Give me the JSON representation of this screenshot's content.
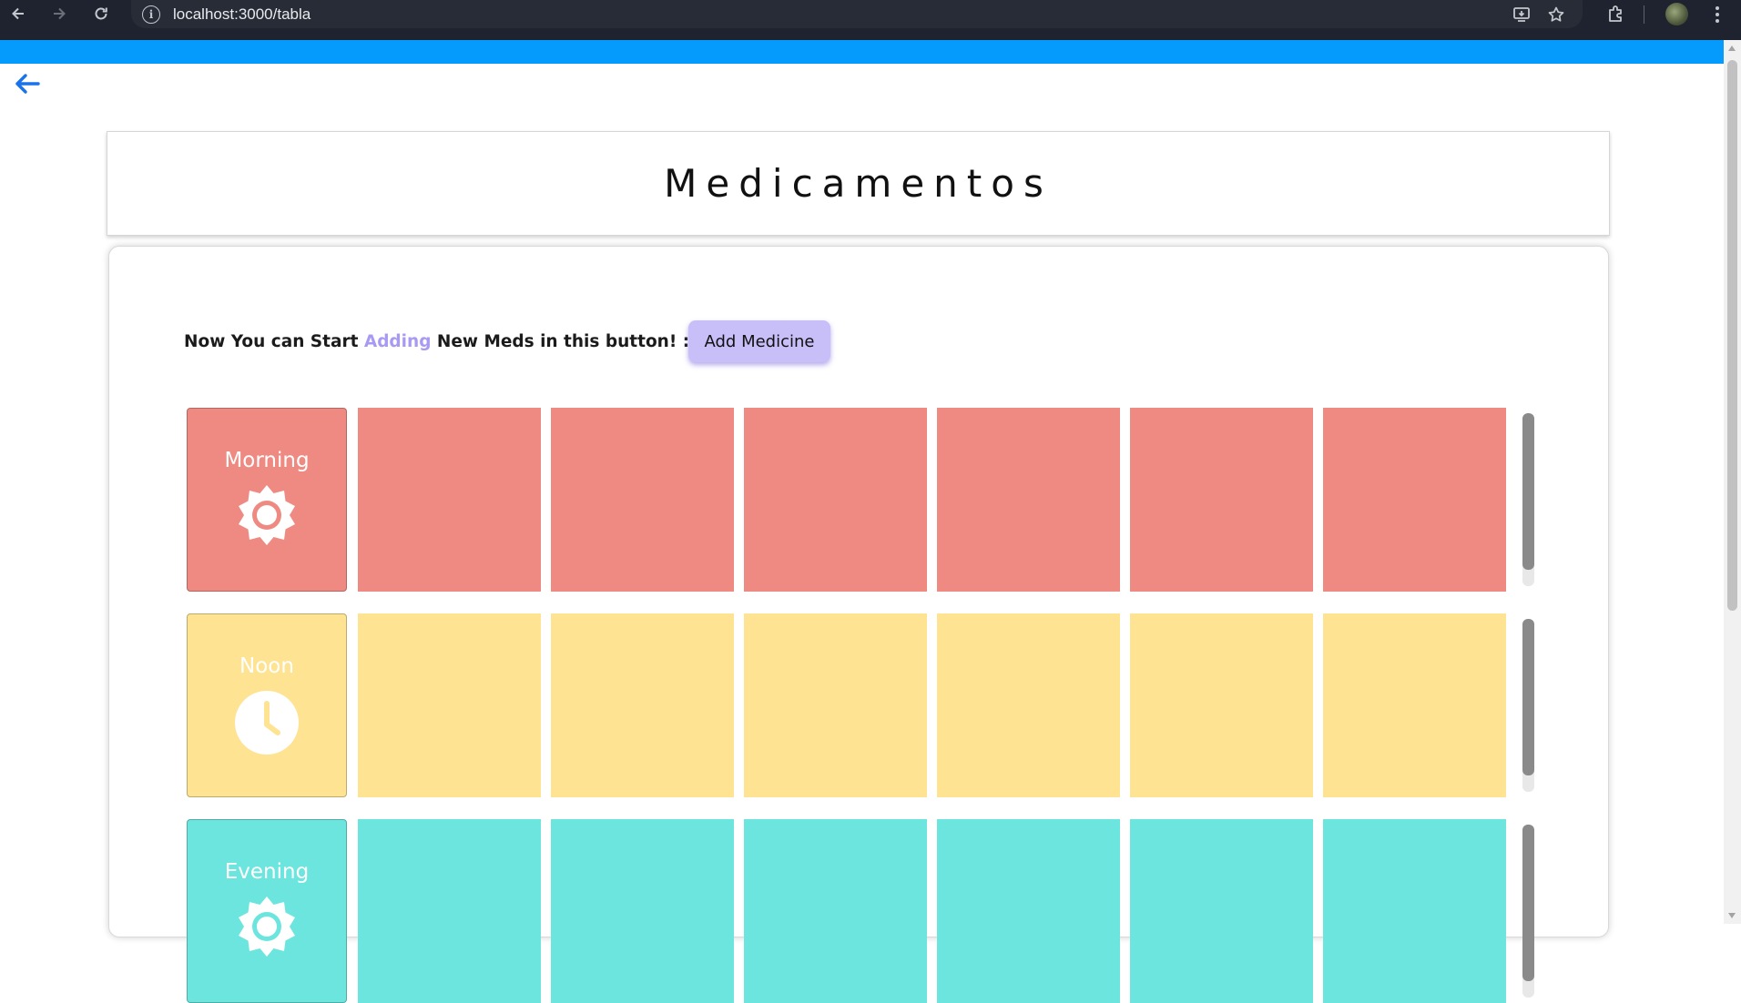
{
  "browser": {
    "url": "localhost:3000/tabla"
  },
  "colors": {
    "app_bar": "#049bfd",
    "back_arrow": "#1a73e8",
    "morning": "#ef8a83",
    "noon": "#fde392",
    "evening": "#6ce5de",
    "accent": "#a89af4",
    "button": "#c8bff9"
  },
  "page": {
    "title": "Medicamentos",
    "cta": {
      "prefix": "Now You can Start ",
      "highlight": "Adding",
      "suffix": " New Meds in this button! :"
    },
    "add_button": "Add Medicine"
  },
  "schedule": [
    {
      "label": "Morning",
      "icon": "sun-icon",
      "day_cells": 6
    },
    {
      "label": "Noon",
      "icon": "clock-icon",
      "day_cells": 6
    },
    {
      "label": "Evening",
      "icon": "sun-icon",
      "day_cells": 6
    }
  ]
}
